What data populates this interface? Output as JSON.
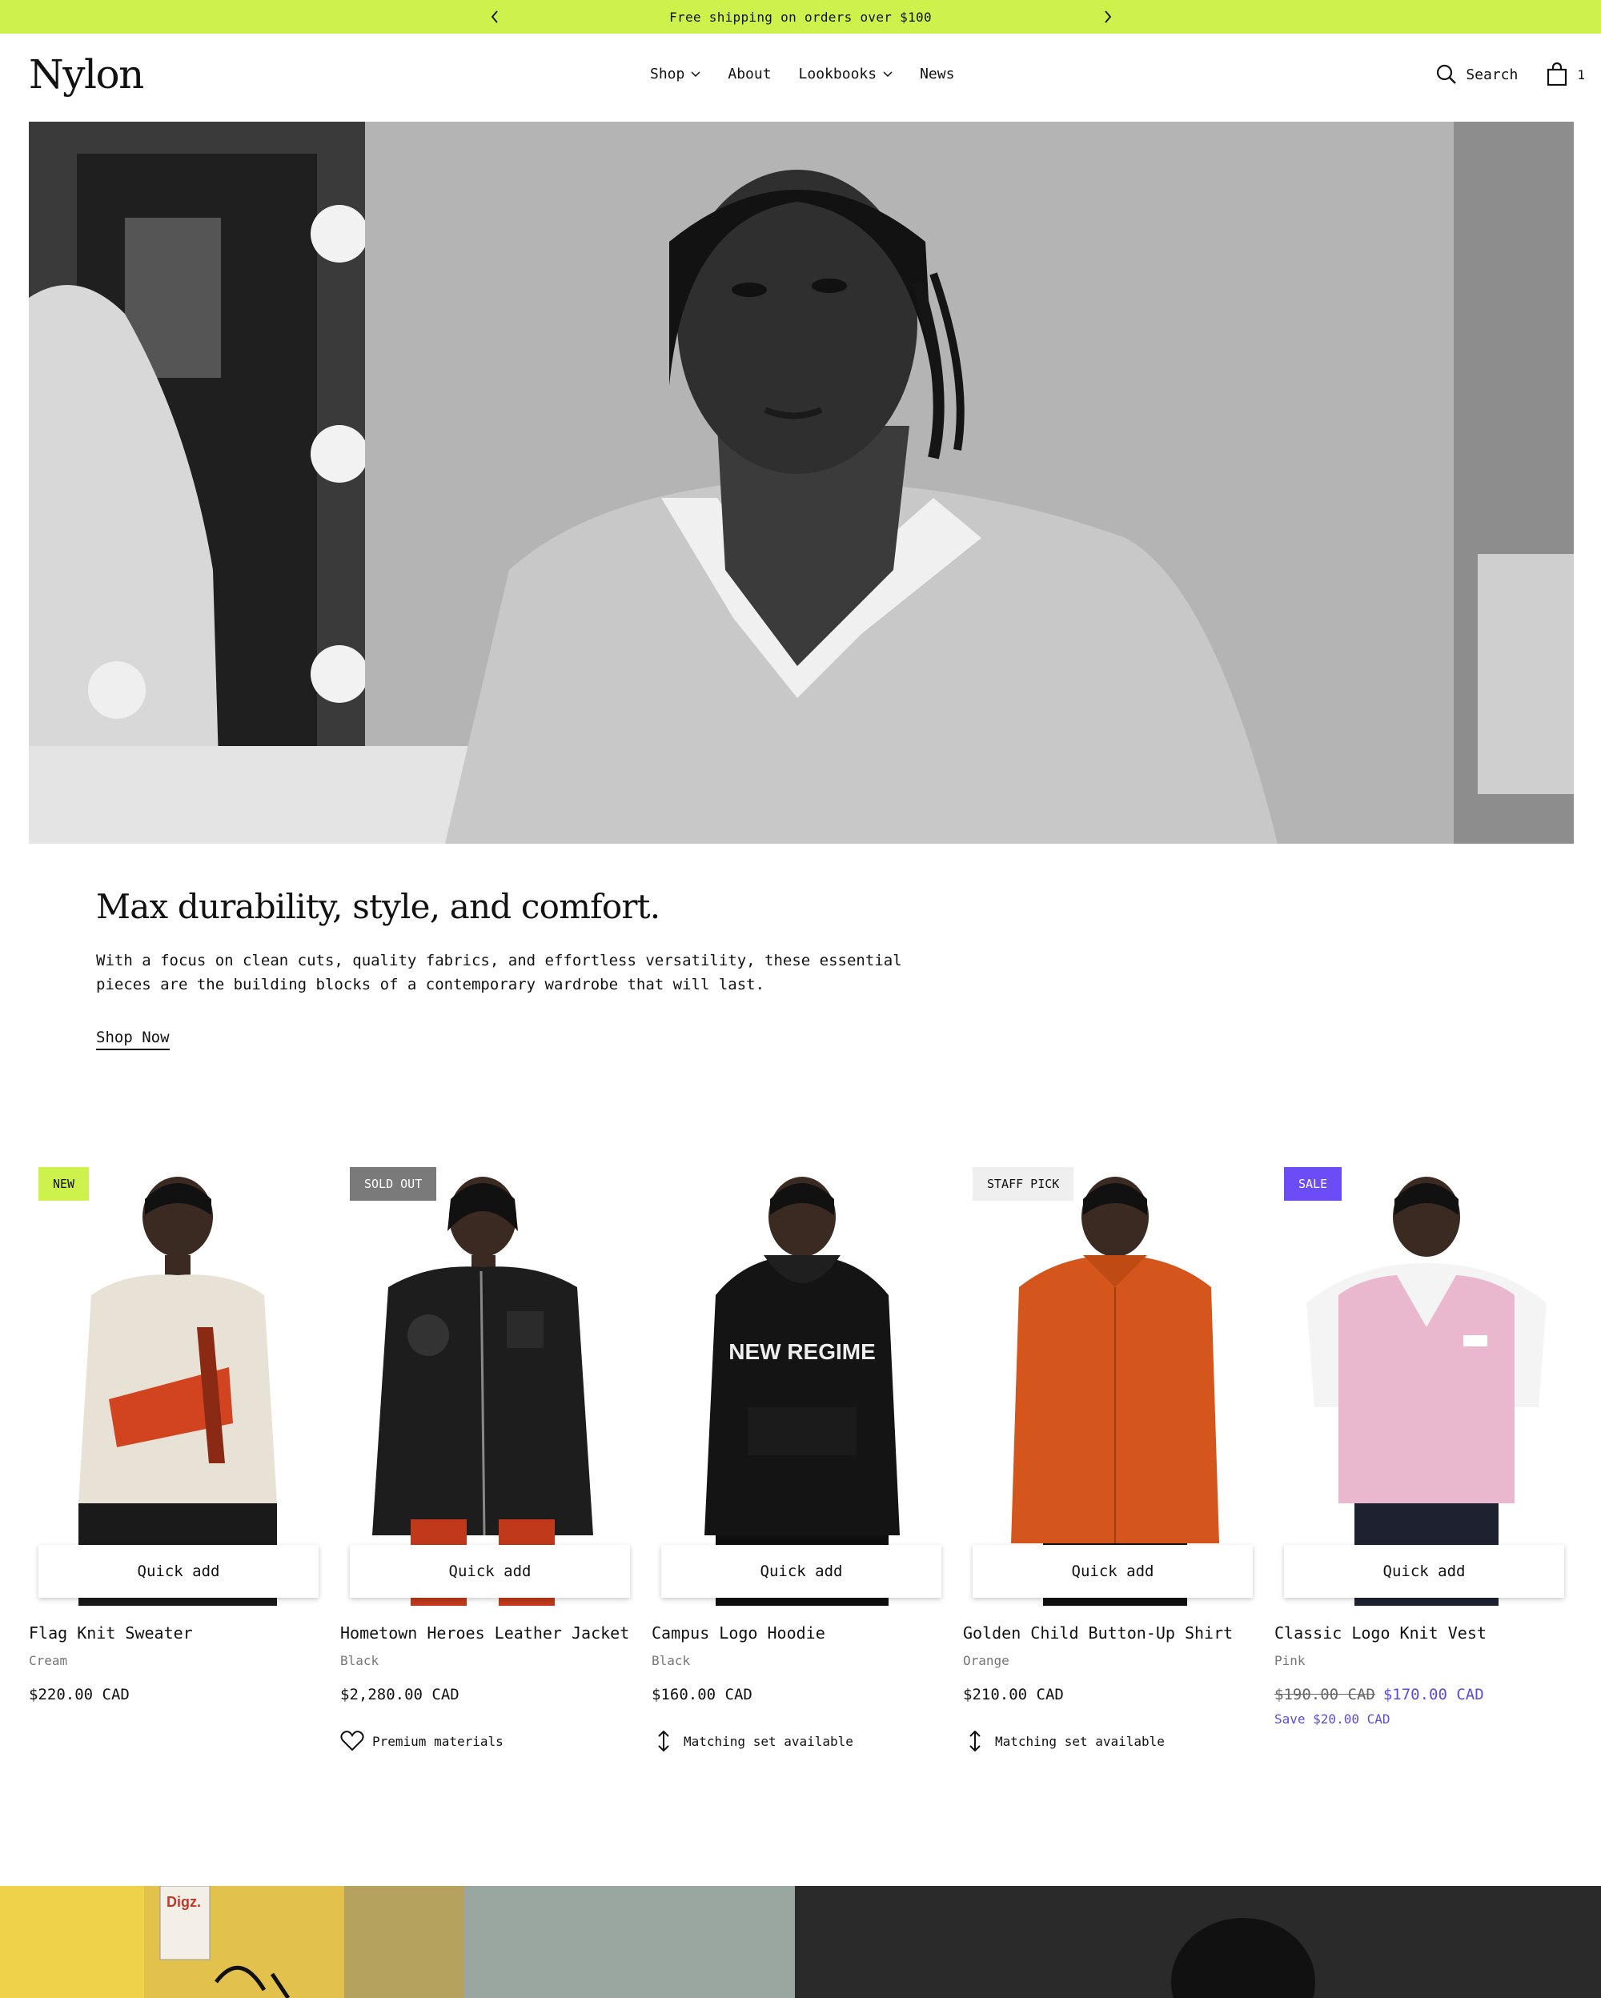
{
  "announcement": {
    "text": "Free shipping on orders over $100",
    "prev_icon": "chevron-left-icon",
    "next_icon": "chevron-right-icon"
  },
  "header": {
    "logo": "Nylon",
    "nav": [
      {
        "label": "Shop",
        "dropdown": true
      },
      {
        "label": "About",
        "dropdown": false
      },
      {
        "label": "Lookbooks",
        "dropdown": true
      },
      {
        "label": "News",
        "dropdown": false
      }
    ],
    "search_label": "Search",
    "cart_count": "1"
  },
  "hero": {
    "title": "Max durability, style, and comfort.",
    "description": "With a focus on clean cuts, quality fabrics, and effortless versatility, these essential pieces are the building blocks of a contemporary wardrobe that will last.",
    "cta": "Shop Now"
  },
  "products": [
    {
      "badge": "NEW",
      "badge_bg": "#cdf24b",
      "badge_fg": "#111111",
      "name": "Flag Knit Sweater",
      "color": "Cream",
      "price": "$220.00 CAD",
      "quick_add": "Quick add",
      "feature": ""
    },
    {
      "badge": "SOLD OUT",
      "badge_bg": "#7a7a7a",
      "badge_fg": "#ffffff",
      "name": "Hometown Heroes Leather Jacket",
      "color": "Black",
      "price": "$2,280.00 CAD",
      "quick_add": "Quick add",
      "feature": "Premium materials",
      "feature_icon": "heart-icon"
    },
    {
      "badge": "",
      "name": "Campus Logo Hoodie",
      "color": "Black",
      "price": "$160.00 CAD",
      "quick_add": "Quick add",
      "feature": "Matching set available",
      "feature_icon": "arrows-vertical-icon"
    },
    {
      "badge": "STAFF PICK",
      "badge_bg": "#efefef",
      "badge_fg": "#111111",
      "name": "Golden Child Button-Up Shirt",
      "color": "Orange",
      "price": "$210.00 CAD",
      "quick_add": "Quick add",
      "feature": "Matching set available",
      "feature_icon": "arrows-vertical-icon"
    },
    {
      "badge": "SALE",
      "badge_bg": "#6b4cf5",
      "badge_fg": "#ffffff",
      "name": "Classic Logo Knit Vest",
      "color": "Pink",
      "price_was": "$190.00 CAD",
      "price_now": "$170.00 CAD",
      "save": "Save $20.00 CAD",
      "quick_add": "Quick add",
      "feature": ""
    }
  ],
  "colors": {
    "accent": "#cdf24b",
    "sale": "#5b4be0"
  }
}
